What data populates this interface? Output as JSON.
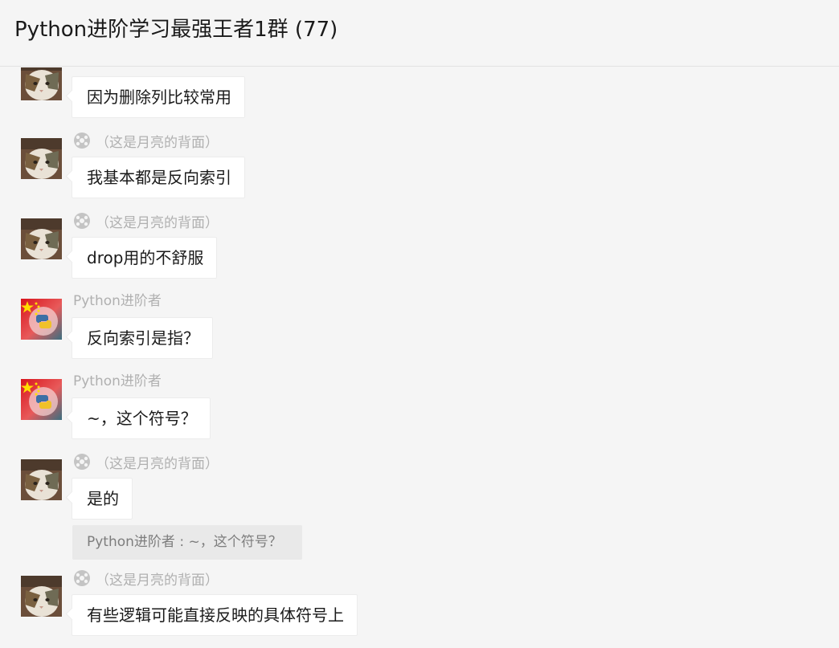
{
  "header": {
    "title": "Python进阶学习最强王者1群 (77)"
  },
  "messages": [
    {
      "sender": "",
      "sender_icon": "basketball-emoji-icon",
      "avatar": "cat-avatar",
      "text": "因为删除列比较常用"
    },
    {
      "sender": "（这是月亮的背面）",
      "sender_icon": "basketball-emoji-icon",
      "avatar": "cat-avatar",
      "text": "我基本都是反向索引"
    },
    {
      "sender": "（这是月亮的背面）",
      "sender_icon": "basketball-emoji-icon",
      "avatar": "cat-avatar",
      "text": "drop用的不舒服"
    },
    {
      "sender": "Python进阶者",
      "sender_icon": "",
      "avatar": "flag-python-avatar",
      "text": "反向索引是指？"
    },
    {
      "sender": "Python进阶者",
      "sender_icon": "",
      "avatar": "flag-python-avatar",
      "text": "~，这个符号？"
    },
    {
      "sender": "（这是月亮的背面）",
      "sender_icon": "basketball-emoji-icon",
      "avatar": "cat-avatar",
      "text": "是的"
    },
    {
      "sender": "（这是月亮的背面）",
      "sender_icon": "basketball-emoji-icon",
      "avatar": "cat-avatar",
      "text": "有些逻辑可能直接反映的具体符号上"
    }
  ],
  "quote": {
    "text": "Python进阶者 : ~，这个符号？"
  },
  "colors": {
    "background": "#f5f5f5",
    "bubble": "#ffffff",
    "sender_text": "#b0b0b0",
    "quote_bg": "#e9e9e9"
  }
}
